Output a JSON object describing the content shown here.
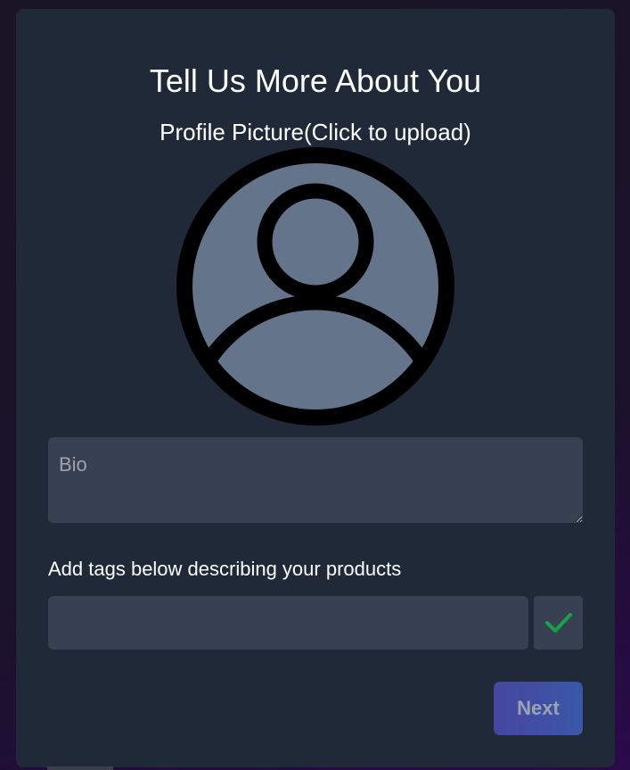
{
  "form": {
    "title": "Tell Us More About You",
    "profile_picture_label": "Profile Picture(Click to upload)",
    "avatar_icon": "user-placeholder-icon",
    "bio_placeholder": "Bio",
    "bio_value": "",
    "tags_label": "Add tags below describing your products",
    "tag_input_value": "",
    "tag_add_icon": "checkmark-icon",
    "next_label": "Next"
  },
  "colors": {
    "card_background": "#1f2937",
    "field_background": "#374151",
    "avatar_fill": "#64748b",
    "checkmark": "#16a34a",
    "next_button": "#3f51a5"
  }
}
